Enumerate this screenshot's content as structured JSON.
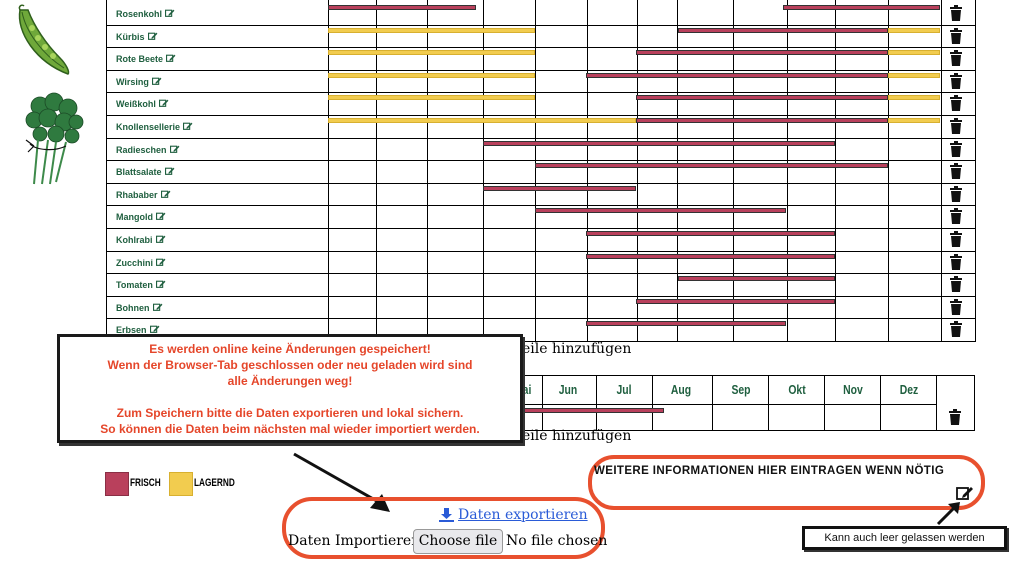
{
  "vegetables": [
    {
      "name": "Rosenkohl"
    },
    {
      "name": "Kürbis"
    },
    {
      "name": "Rote Beete"
    },
    {
      "name": "Wirsing"
    },
    {
      "name": "Weißkohl"
    },
    {
      "name": "Knollensellerie"
    },
    {
      "name": "Radieschen"
    },
    {
      "name": "Blattsalate"
    },
    {
      "name": "Rhababer"
    },
    {
      "name": "Mangold"
    },
    {
      "name": "Kohlrabi"
    },
    {
      "name": "Zucchini"
    },
    {
      "name": "Tomaten"
    },
    {
      "name": "Bohnen"
    },
    {
      "name": "Erbsen"
    }
  ],
  "add_row_label": "eile hinzufügen",
  "months_visible": [
    "ai",
    "Jun",
    "Jul",
    "Aug",
    "Sep",
    "Okt",
    "Nov",
    "Dez"
  ],
  "add_row_label_2": "eile hinzufügen",
  "warning": {
    "line1": "Es werden online keine Änderungen gespeichert!",
    "line2": "Wenn der Browser-Tab geschlossen oder neu geladen wird sind",
    "line3": "alle Änderungen weg!",
    "line4": "Zum Speichern bitte die Daten exportieren und lokal sichern.",
    "line5": "So können die Daten beim nächsten mal wieder importiert werden."
  },
  "legend": {
    "frisch_label": "FRISCH",
    "lagernd_label": "LAGERND",
    "frisch_color": "#b9405c",
    "lagernd_color": "#f2cc4f"
  },
  "export": {
    "link_label": "Daten exportieren",
    "import_label": "Daten Importieren",
    "choose_label": "Choose file",
    "file_status": "No file chosen"
  },
  "info": {
    "placeholder_text": "WEITERE INFORMATIONEN HIER EINTRAGEN WENN NÖTIG",
    "note": "Kann auch leer gelassen werden"
  },
  "icons": [
    "edit-icon",
    "trash-icon",
    "download-icon",
    "pea-pod-icon",
    "herb-bunch-icon",
    "arrow-icon"
  ]
}
